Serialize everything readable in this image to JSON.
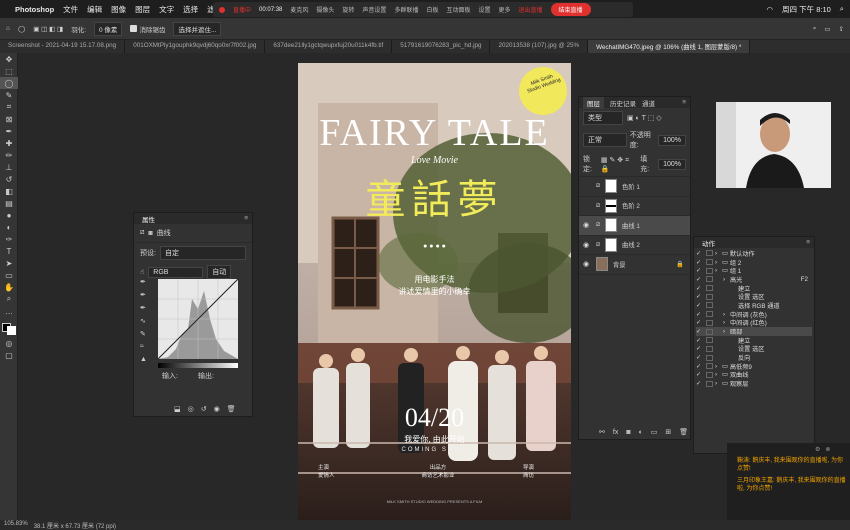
{
  "menubar": {
    "apple": "",
    "app": "Photoshop",
    "items": [
      "文件",
      "编辑",
      "图像",
      "图层",
      "文字",
      "选择",
      "滤"
    ],
    "clock": "周四 下午 8:10"
  },
  "live": {
    "status": "直播中",
    "time": "00:07:38",
    "items": [
      "麦克风",
      "摄像头",
      "旋转",
      "声音设置",
      "多群联播",
      "白板",
      "互动面板",
      "设置",
      "更多"
    ],
    "exit": "退出直播",
    "end": "结束直播"
  },
  "options": {
    "feather_label": "羽化:",
    "feather": "0 像素",
    "antialias": "消除锯齿",
    "select_mask": "选择并遮住..."
  },
  "tabs": [
    "Screenshot - 2021-04-19 15.17.08.png",
    "001OXMtPly1gouphk9qvdj60qo0xr7f002.jpg",
    "637dee21lly1gctqwupxfuj20u011k4fb.tif",
    "517916190762​83_pic_hd.jpg",
    "202013538 (107).jpg @ 25%",
    "WechatIMG470.jpeg @ 106% (曲线 1, 图层蒙版/8) *"
  ],
  "poster": {
    "badge": "Milk Smith Studio Wedding",
    "title": "FAIRY TALE",
    "subtitle": "Love Movie",
    "cn_title": "童話夢",
    "line1": "用电影手法",
    "line2": "讲述爱情里的小确幸",
    "date": "04/20",
    "tag": "我爱你, 由此开始",
    "coming": "COMING SOON",
    "credits_left": "主演\n爱情人",
    "credits_mid": "出品方\n商访艺术影业",
    "credits_right": "导演\n商访",
    "fine": "MILK SMITH STUDIO WEDDING PRESENTS A FILM"
  },
  "status": {
    "zoom": "105.83%",
    "dims": "38.1 厘米 x 67.73 厘米 (72 ppi)"
  },
  "curves": {
    "tab": "属性",
    "name": "曲线",
    "preset_label": "预设:",
    "preset": "自定",
    "channel": "RGB",
    "auto": "自动",
    "input": "输入:",
    "output": "输出:"
  },
  "layers": {
    "tabs": [
      "图层",
      "历史记录",
      "通道"
    ],
    "kind": "类型",
    "mode": "正常",
    "opacity_label": "不透明度:",
    "opacity": "100%",
    "lock": "锁定:",
    "fill_label": "填充:",
    "fill": "100%",
    "rows": [
      {
        "name": "色阶 1",
        "eye": false
      },
      {
        "name": "色阶 2",
        "eye": false
      },
      {
        "name": "曲线 1",
        "eye": true
      },
      {
        "name": "曲线 2",
        "eye": true
      },
      {
        "name": "背景",
        "eye": true
      }
    ]
  },
  "actions": {
    "tab": "动作",
    "rows": [
      {
        "t": "默认动作",
        "lvl": 0,
        "fold": true
      },
      {
        "t": "组 2",
        "lvl": 0,
        "fold": true
      },
      {
        "t": "组 1",
        "lvl": 0,
        "fold": true
      },
      {
        "t": "高光",
        "lvl": 1,
        "key": "F2"
      },
      {
        "t": "建立",
        "lvl": 2
      },
      {
        "t": "设置 选区",
        "lvl": 2
      },
      {
        "t": "选择 RGB 通道",
        "lvl": 2
      },
      {
        "t": "中间调 (灰色)",
        "lvl": 1
      },
      {
        "t": "中间调 (红色)",
        "lvl": 1
      },
      {
        "t": "暗部",
        "lvl": 1
      },
      {
        "t": "建立",
        "lvl": 2
      },
      {
        "t": "设置 选区",
        "lvl": 2
      },
      {
        "t": "反向",
        "lvl": 2
      },
      {
        "t": "高低频9",
        "lvl": 0,
        "fold": true
      },
      {
        "t": "双曲线",
        "lvl": 0,
        "fold": true
      },
      {
        "t": "观察层",
        "lvl": 0,
        "fold": true
      }
    ]
  },
  "chat": {
    "line1": "鞠涛: 鹅庆丰, 我来围观你的直播啦, 为你点赞!",
    "line2": "三月印象王嘉: 鹅庆丰, 我来围观你的直播啦, 为你点赞!"
  }
}
